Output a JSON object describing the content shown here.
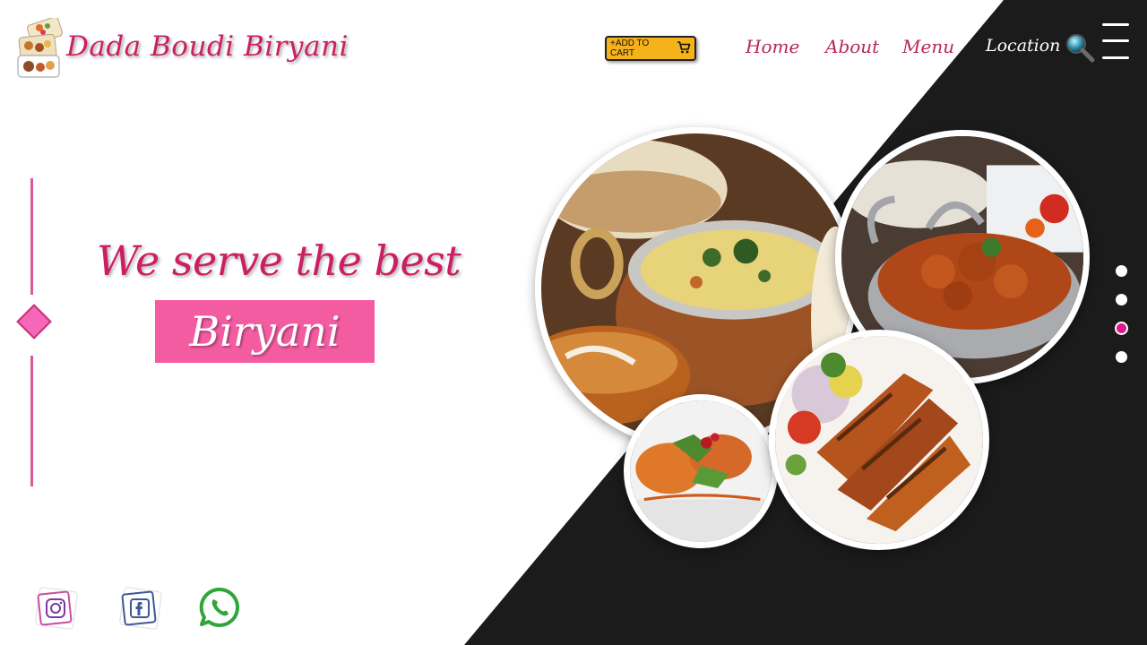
{
  "header": {
    "brand": "Dada Boudi Biryani",
    "logo_icon": "biryani-box-logo",
    "cart_label": "+ADD TO CART",
    "cart_icon": "cart-icon",
    "nav": {
      "home": "Home",
      "about": "About",
      "menu": "Menu",
      "location": "Location"
    },
    "search_icon": "search-icon",
    "menu_icon": "hamburger-icon"
  },
  "hero": {
    "tagline": "We serve the best",
    "highlight": "Biryani"
  },
  "gallery": {
    "images": [
      "biryani-pot-image",
      "chicken-curry-image",
      "grilled-chicken-salad-image",
      "chicken-tikka-image"
    ]
  },
  "slider": {
    "dots": 4,
    "active_index": 2
  },
  "social": {
    "icons": [
      "instagram-icon",
      "facebook-icon",
      "whatsapp-icon"
    ]
  },
  "colors": {
    "brand_pink": "#cc1f63",
    "badge_pink": "#f45ca2",
    "dark_panel": "#1b1b1b",
    "cart_button": "#f6b21a",
    "active_dot": "#e0168d"
  }
}
